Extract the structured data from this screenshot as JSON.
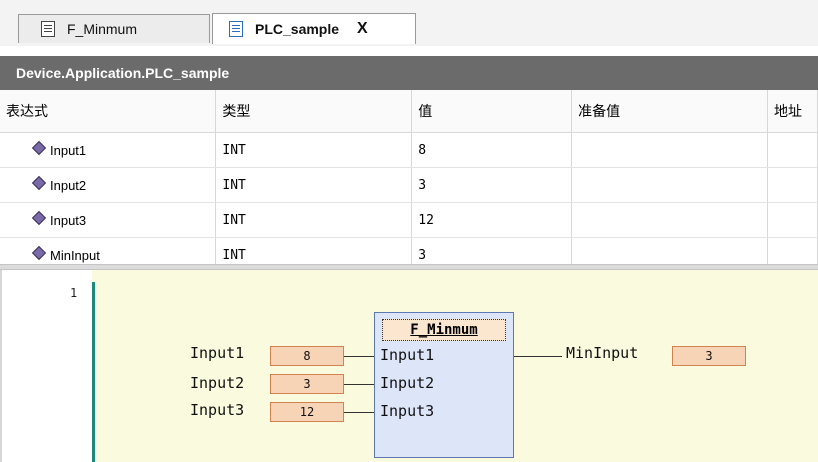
{
  "tabs": [
    {
      "label": "F_Minmum",
      "active": false
    },
    {
      "label": "PLC_sample",
      "active": true,
      "close_glyph": "X"
    }
  ],
  "path": "Device.Application.PLC_sample",
  "watch": {
    "columns": [
      "表达式",
      "类型",
      "值",
      "准备值",
      "地址"
    ],
    "rows": [
      {
        "expr": "Input1",
        "type": "INT",
        "value": "8",
        "prepared": "",
        "address": ""
      },
      {
        "expr": "Input2",
        "type": "INT",
        "value": "3",
        "prepared": "",
        "address": ""
      },
      {
        "expr": "Input3",
        "type": "INT",
        "value": "12",
        "prepared": "",
        "address": ""
      },
      {
        "expr": "MinInput",
        "type": "INT",
        "value": "3",
        "prepared": "",
        "address": ""
      }
    ]
  },
  "editor": {
    "line_number": "1",
    "block_name": "F_Minmum",
    "inputs": [
      {
        "var": "Input1",
        "value": "8",
        "pin": "Input1"
      },
      {
        "var": "Input2",
        "value": "3",
        "pin": "Input2"
      },
      {
        "var": "Input3",
        "value": "12",
        "pin": "Input3"
      }
    ],
    "output": {
      "var": "MinInput",
      "value": "3"
    }
  },
  "colors": {
    "editor_bg": "#fafadf",
    "value_box": "#f8d4b6",
    "block_bg": "#dde6f8",
    "header_bg": "#6b6b6b"
  },
  "icons": [
    "pou-document-icon",
    "program-icon",
    "close-icon",
    "variable-icon"
  ]
}
